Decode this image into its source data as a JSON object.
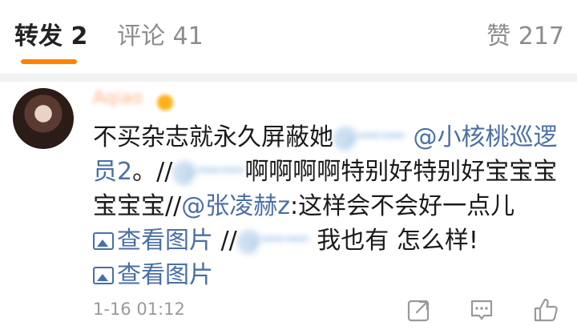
{
  "tabs": {
    "repost": "转发 2",
    "comment": "评论 41",
    "like": "赞 217"
  },
  "comment": {
    "username": "Aqiao",
    "text": {
      "p1": "不买杂志就永久屏蔽她",
      "blur1": "@一一",
      "m1": "@小核桃巡逻员2",
      "p2": "。//",
      "blur2": "@一一",
      "p3": "啊啊啊啊特别好特别好宝宝宝宝宝宝//",
      "m2": "@张凌赫z",
      "p4": ":这样会不会好一点儿 ",
      "link1": "查看图片",
      "p5": " //",
      "blur3": "@一一",
      "p6": " 我也有 怎么样!",
      "link2": "查看图片"
    },
    "timestamp": "1-16 01:12"
  },
  "icons": [
    "image-icon",
    "repost-icon",
    "comment-icon",
    "like-icon"
  ],
  "colors": {
    "accent": "#ff8200",
    "link": "#4a6fa5",
    "muted": "#9a9a9a"
  }
}
